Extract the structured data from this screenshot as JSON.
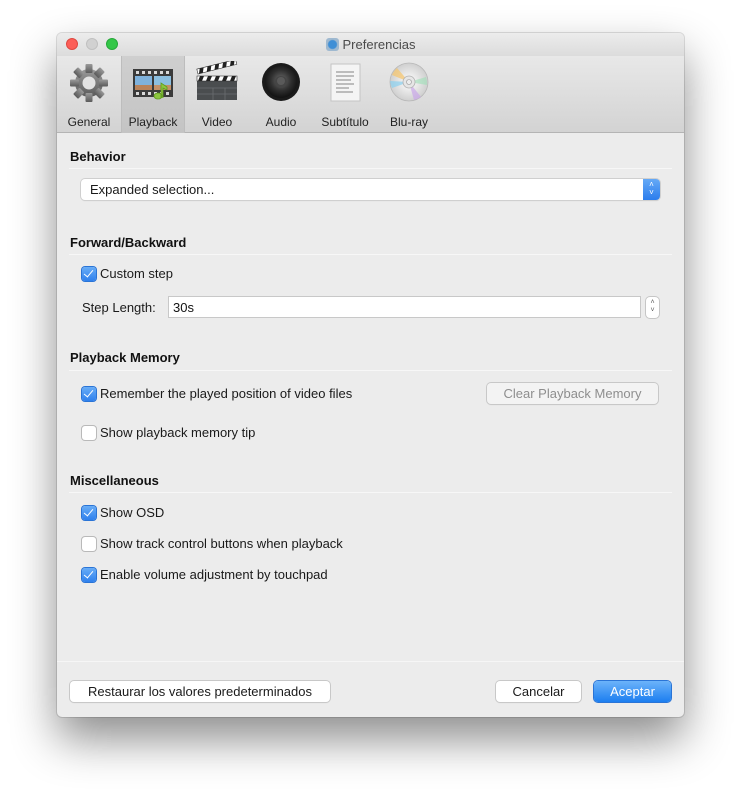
{
  "window": {
    "title": "Preferencias",
    "title_icon": "app-icon"
  },
  "toolbar": {
    "items": [
      {
        "label": "General",
        "icon": "gear-icon",
        "active": false
      },
      {
        "label": "Playback",
        "icon": "film-music-icon",
        "active": true
      },
      {
        "label": "Video",
        "icon": "clapperboard-icon",
        "active": false
      },
      {
        "label": "Audio",
        "icon": "speaker-icon",
        "active": false
      },
      {
        "label": "Subtítulo",
        "icon": "document-icon",
        "active": false
      },
      {
        "label": "Blu-ray",
        "icon": "disc-icon",
        "active": false
      }
    ]
  },
  "sections": {
    "behavior": {
      "title": "Behavior",
      "popup_value": "Expanded selection..."
    },
    "forward_backward": {
      "title": "Forward/Backward",
      "custom_step_label": "Custom step",
      "custom_step_checked": true,
      "step_length_label": "Step Length:",
      "step_length_value": "30s"
    },
    "playback_memory": {
      "title": "Playback Memory",
      "remember_label": "Remember the played position of video files",
      "remember_checked": true,
      "clear_button": "Clear Playback Memory",
      "tip_label": "Show playback memory tip",
      "tip_checked": false
    },
    "misc": {
      "title": "Miscellaneous",
      "show_osd_label": "Show OSD",
      "show_osd_checked": true,
      "track_buttons_label": "Show track control buttons when playback",
      "track_buttons_checked": false,
      "volume_touchpad_label": "Enable volume adjustment by touchpad",
      "volume_touchpad_checked": true
    }
  },
  "footer": {
    "restore_label": "Restaurar los valores predeterminados",
    "cancel_label": "Cancelar",
    "accept_label": "Aceptar"
  },
  "colors": {
    "accent": "#2f80ed",
    "close": "#fc5e57",
    "minimize": "#d1d1d1",
    "maximize": "#34c748"
  }
}
